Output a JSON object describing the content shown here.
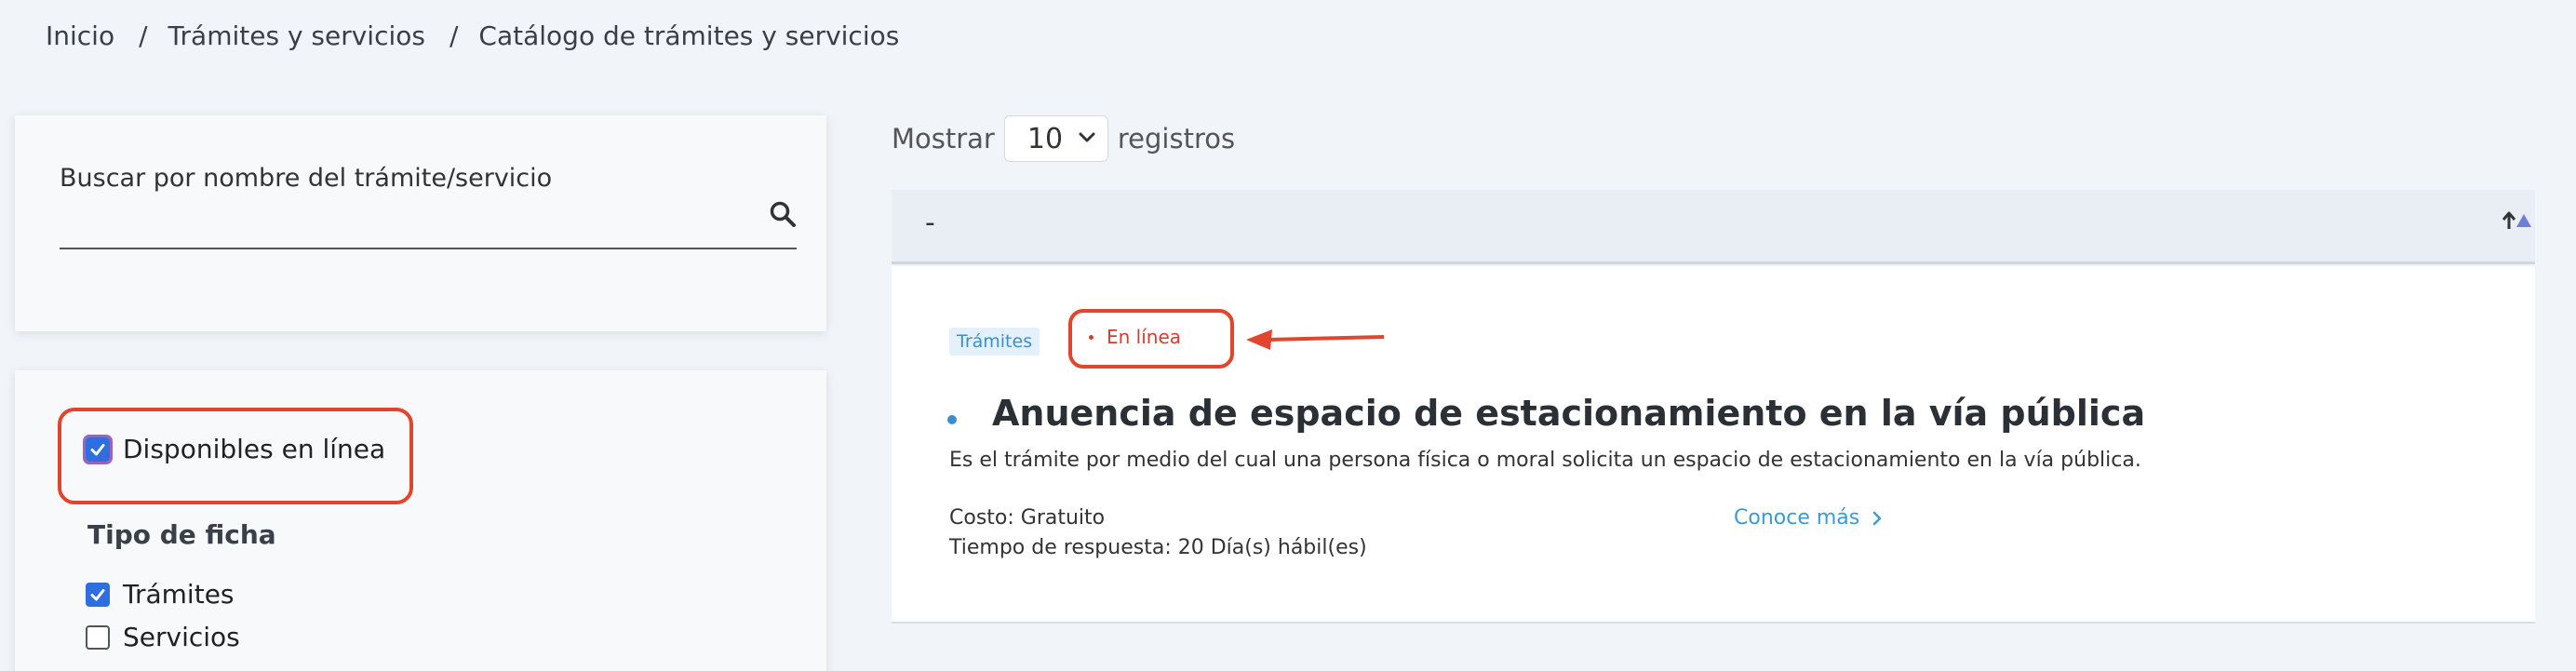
{
  "breadcrumb": {
    "items": [
      "Inicio",
      "Trámites y servicios",
      "Catálogo de trámites y servicios"
    ],
    "separator": "/"
  },
  "search": {
    "label": "Buscar por nombre del trámite/servicio",
    "value": "",
    "icon": "search-icon"
  },
  "filters": {
    "online": {
      "label": "Disponibles en línea",
      "checked": true
    },
    "type_title": "Tipo de ficha",
    "types": [
      {
        "label": "Trámites",
        "checked": true
      },
      {
        "label": "Servicios",
        "checked": false
      }
    ]
  },
  "pagination": {
    "show_label": "Mostrar",
    "page_size": "10",
    "records_label": "registros"
  },
  "table": {
    "header_text": "-",
    "sort_icon": "sort-asc-icon"
  },
  "result": {
    "tag_type": "Trámites",
    "tag_online": "En línea",
    "title": "Anuencia de espacio de estacionamiento en la vía pública",
    "description": "Es el trámite por medio del cual una persona física o moral solicita un espacio de estacionamiento en la vía pública.",
    "cost": "Costo: Gratuito",
    "response_time": "Tiempo de respuesta: 20 Día(s) hábil(es)",
    "more_link": "Conoce más"
  },
  "colors": {
    "accent_blue": "#3a9bd4",
    "highlight_red": "#e2452d",
    "checkbox_blue": "#2f6ee0"
  }
}
